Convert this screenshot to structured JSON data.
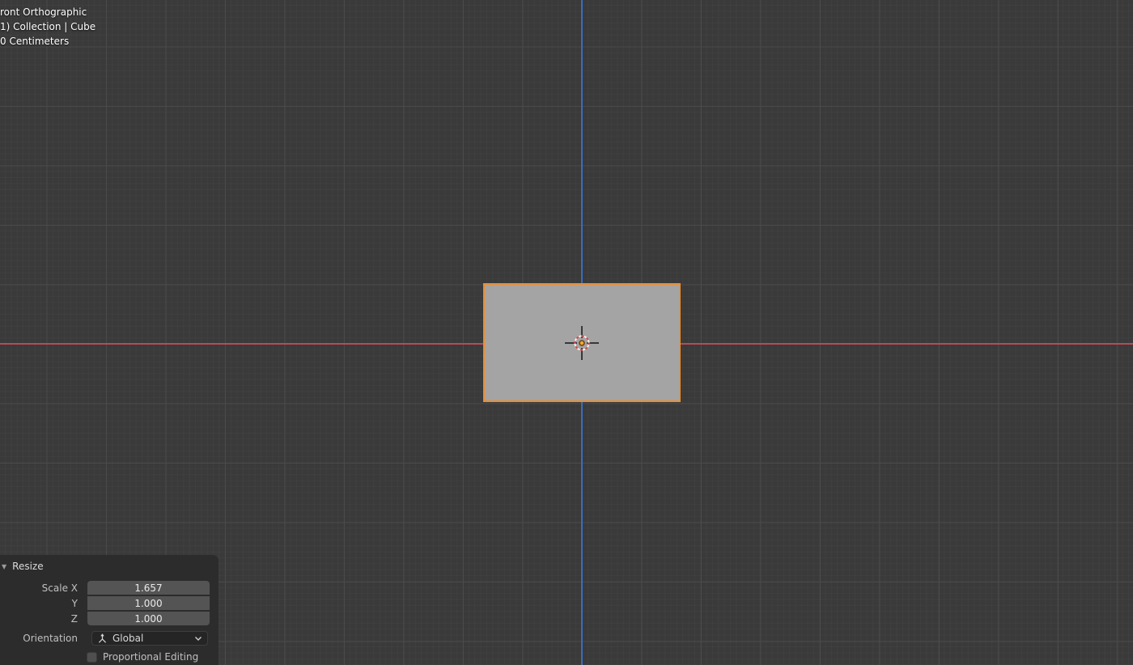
{
  "colors": {
    "background": "#3a3a3a",
    "grid_major": "#4a4a4a",
    "axis_x": "#b94b55",
    "axis_z": "#3a6cbc",
    "object_fill": "#a4a4a4",
    "object_outline": "#ee8d2c",
    "panel_bg": "#2c2c2c",
    "field_bg": "#545454"
  },
  "viewport": {
    "text_lines": [
      "ront Orthographic",
      "1) Collection | Cube",
      "0 Centimeters"
    ],
    "object_name": "Cube"
  },
  "resize_panel": {
    "title": "Resize",
    "collapse_icon": "▼",
    "scale_fields": [
      {
        "label": "Scale X",
        "value": "1.657"
      },
      {
        "label": "Y",
        "value": "1.000"
      },
      {
        "label": "Z",
        "value": "1.000"
      }
    ],
    "orientation": {
      "label": "Orientation",
      "value": "Global"
    },
    "proportional_editing": {
      "label": "Proportional Editing",
      "checked": false
    }
  }
}
